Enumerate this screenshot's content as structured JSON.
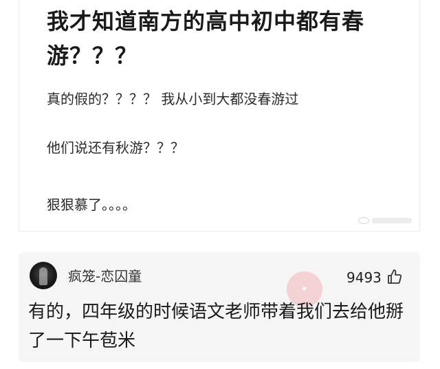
{
  "post": {
    "title": "我才知道南方的高中初中都有春游？？？",
    "lines": [
      "真的假的？？？？ 我从小到大都没春游过",
      "他们说还有秋游？？？",
      "狠狠慕了。。。。"
    ],
    "watermark_icon": "weibo-icon"
  },
  "comment": {
    "username": "疯笼-恋囚童",
    "likes": "9493",
    "like_icon": "thumbs-up-icon",
    "text": "有的，四年级的时候语文老师带着我们去给他掰了一下午苞米",
    "avatar_icon": "avatar"
  },
  "colors": {
    "comment_bg": "#f5f5f5",
    "stamp": "#eb7878"
  }
}
